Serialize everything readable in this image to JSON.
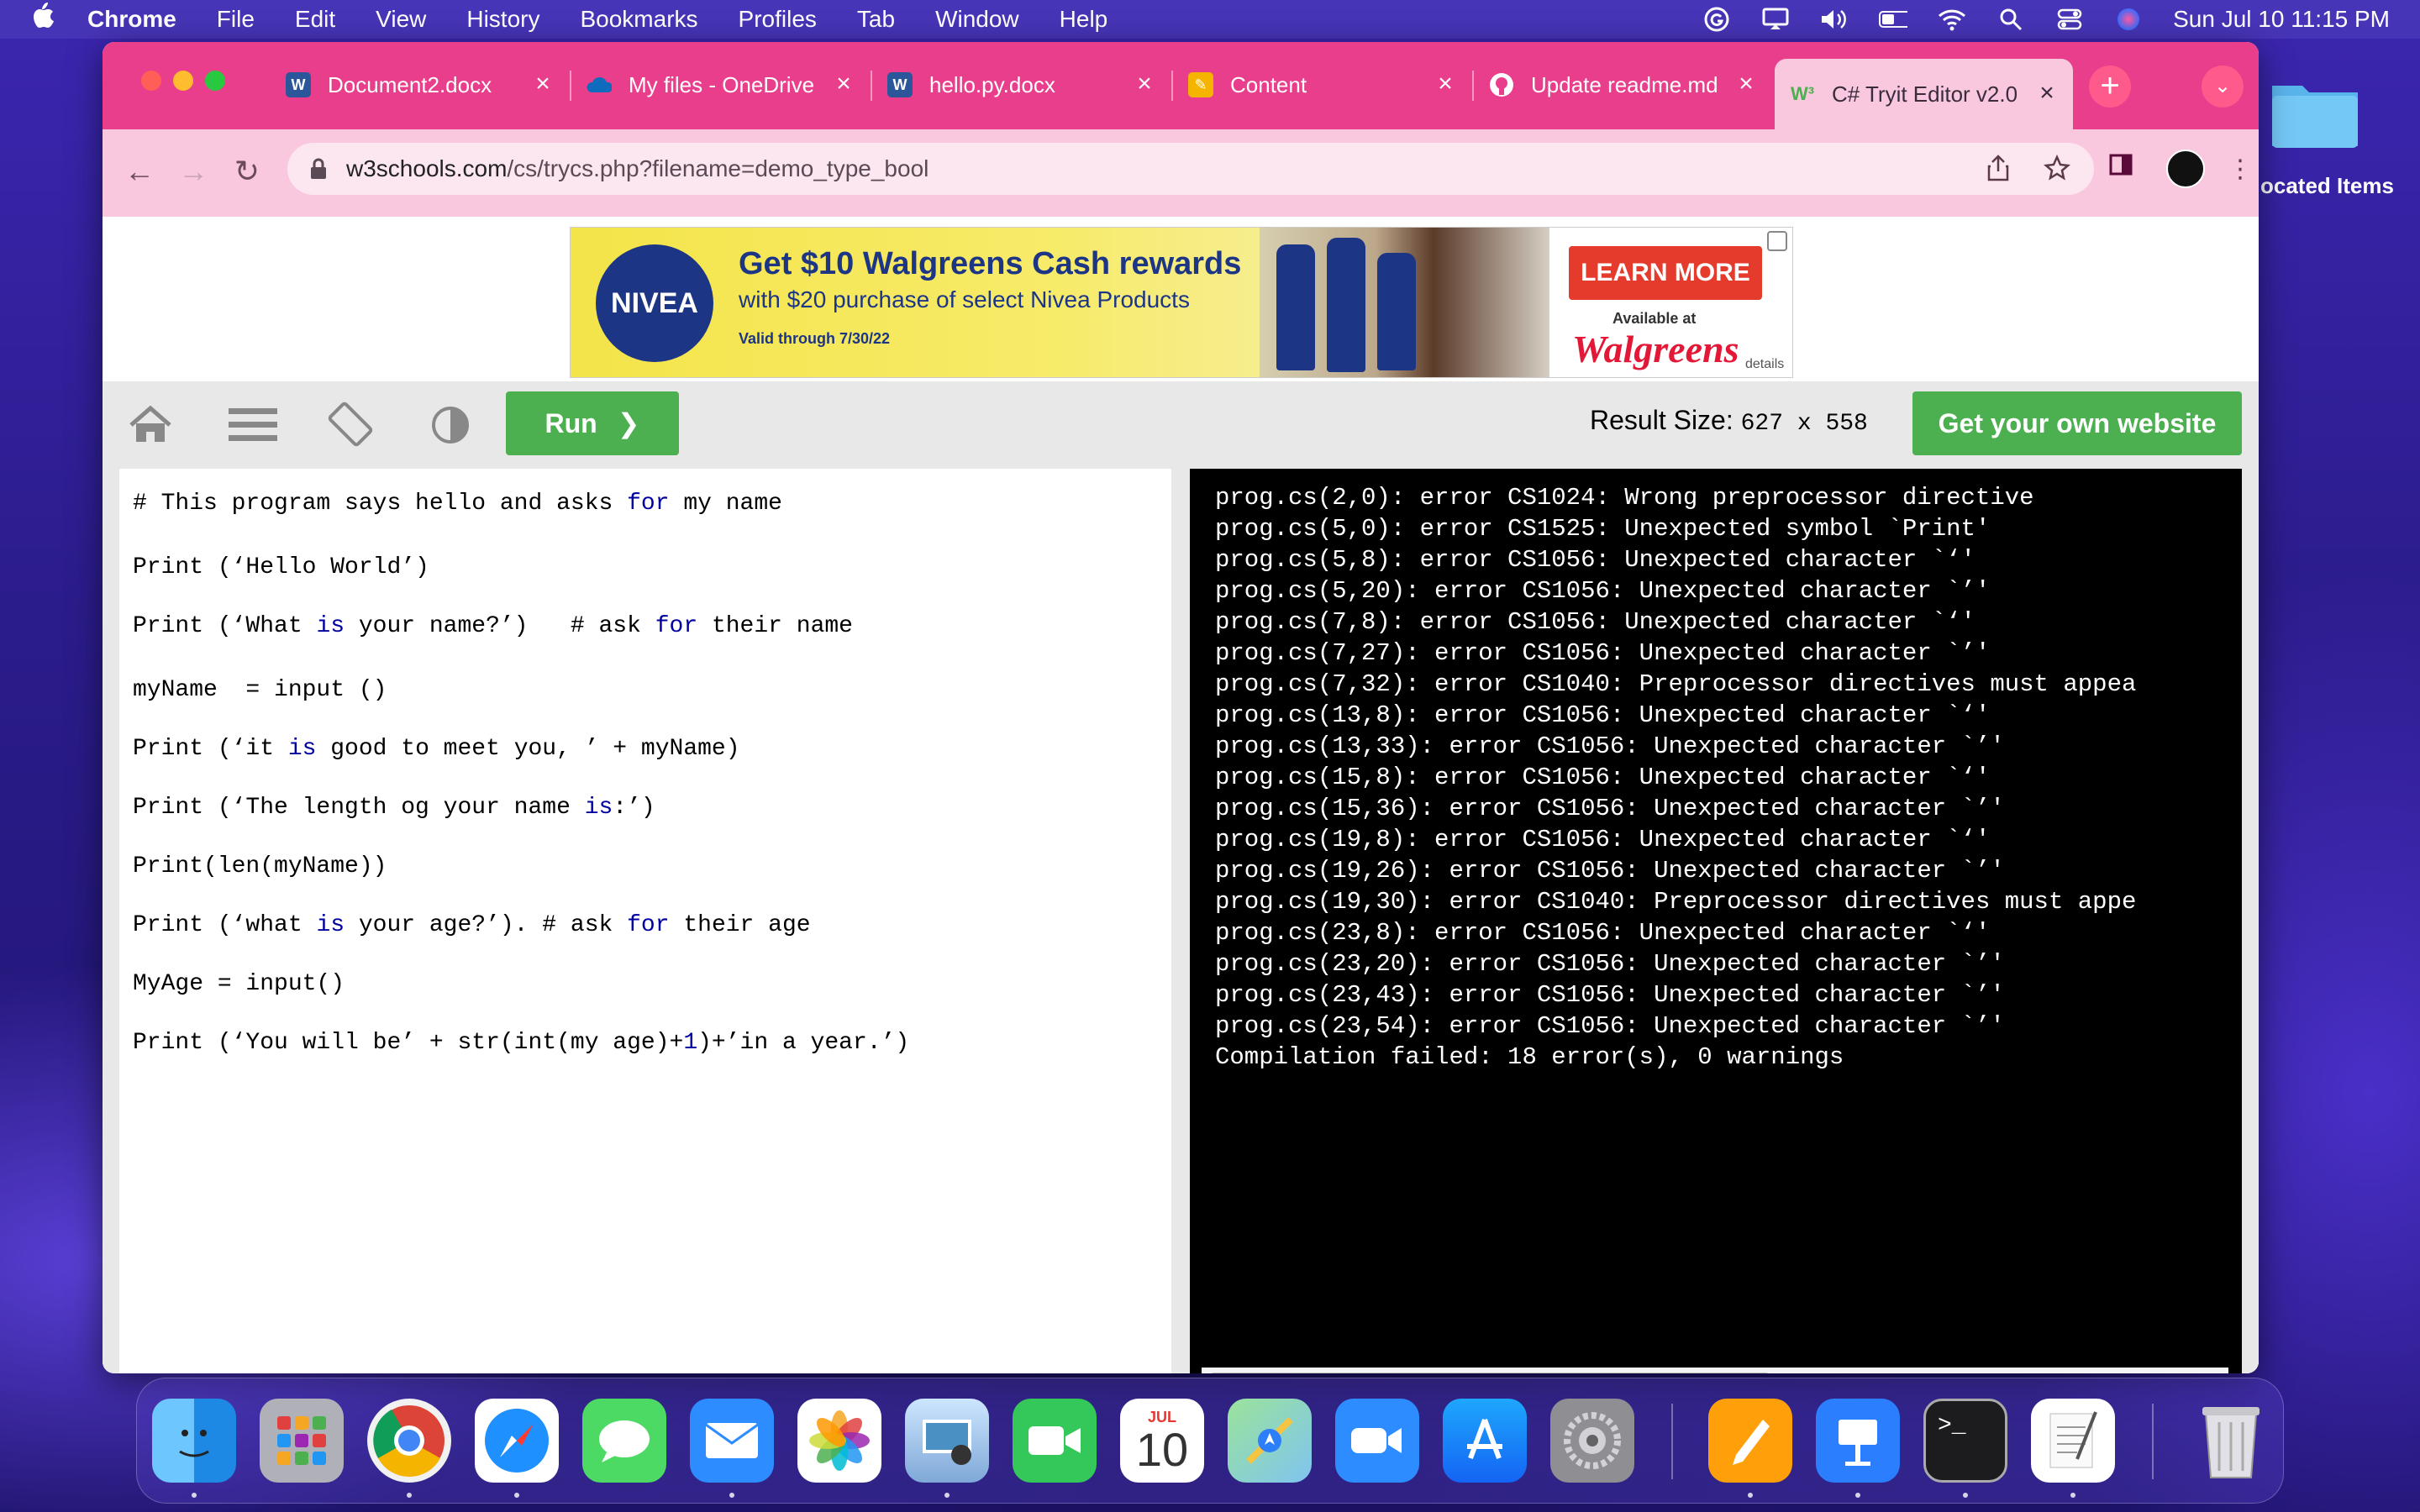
{
  "menubar": {
    "app_name": "Chrome",
    "items": [
      "File",
      "Edit",
      "View",
      "History",
      "Bookmarks",
      "Profiles",
      "Tab",
      "Window",
      "Help"
    ],
    "clock": "Sun Jul 10  11:15 PM"
  },
  "desktop": {
    "folder_label": "ocated Items"
  },
  "tabs": [
    {
      "title": "Document2.docx",
      "icon": "word-icon"
    },
    {
      "title": "My files - OneDrive",
      "icon": "onedrive-icon"
    },
    {
      "title": "hello.py.docx",
      "icon": "word-icon"
    },
    {
      "title": "Content",
      "icon": "notes-icon"
    },
    {
      "title": "Update readme.md",
      "icon": "github-icon"
    },
    {
      "title": "C# Tryit Editor v2.0",
      "icon": "w3schools-icon",
      "active": true
    }
  ],
  "address": {
    "host": "w3schools.com",
    "path": "/cs/trycs.php?filename=demo_type_bool"
  },
  "ad": {
    "brand": "NIVEA",
    "headline": "Get $10 Walgreens Cash rewards",
    "subline": "with $20 purchase of select Nivea Products",
    "valid": "Valid through 7/30/22",
    "cta": "LEARN MORE",
    "available": "Available at",
    "store": "Walgreens",
    "details": "details"
  },
  "w3toolbar": {
    "run_label": "Run",
    "result_size_label": "Result Size:",
    "result_size_value": "627 x 558",
    "get_own_label": "Get your own website"
  },
  "code": [
    {
      "parts": [
        [
          "t",
          "# This program says hello and asks "
        ],
        [
          "k",
          "for"
        ],
        [
          "t",
          " my name"
        ]
      ]
    },
    {
      "parts": []
    },
    {
      "parts": [
        [
          "t",
          "Print (‘Hello World’)"
        ]
      ]
    },
    {
      "parts": [
        [
          "t",
          "Print (‘What "
        ],
        [
          "k",
          "is"
        ],
        [
          "t",
          " your name?’)   # ask "
        ],
        [
          "k",
          "for"
        ],
        [
          "t",
          " their name"
        ]
      ]
    },
    {
      "parts": []
    },
    {
      "parts": [
        [
          "t",
          "myName  = input ()"
        ]
      ]
    },
    {
      "parts": [
        [
          "t",
          "Print (‘it "
        ],
        [
          "k",
          "is"
        ],
        [
          "t",
          " good to meet you, ’ + myName)"
        ]
      ]
    },
    {
      "parts": [
        [
          "t",
          "Print (‘The length og your name "
        ],
        [
          "k",
          "is"
        ],
        [
          "t",
          ":’)"
        ]
      ]
    },
    {
      "parts": [
        [
          "t",
          "Print(len(myName))"
        ]
      ]
    },
    {
      "parts": [
        [
          "t",
          "Print (‘what "
        ],
        [
          "k",
          "is"
        ],
        [
          "t",
          " your age?’). # ask "
        ],
        [
          "k",
          "for"
        ],
        [
          "t",
          " their age"
        ]
      ]
    },
    {
      "parts": [
        [
          "t",
          "MyAge = input()"
        ]
      ]
    },
    {
      "parts": [
        [
          "t",
          "Print (‘You will be’ + str(int(my age)+"
        ],
        [
          "k",
          "1"
        ],
        [
          "t",
          ")+’in a year.’)"
        ]
      ]
    }
  ],
  "output": [
    "prog.cs(2,0): error CS1024: Wrong preprocessor directive",
    "prog.cs(5,0): error CS1525: Unexpected symbol `Print'",
    "prog.cs(5,8): error CS1056: Unexpected character `‘'",
    "prog.cs(5,20): error CS1056: Unexpected character `’'",
    "prog.cs(7,8): error CS1056: Unexpected character `‘'",
    "prog.cs(7,27): error CS1056: Unexpected character `’'",
    "prog.cs(7,32): error CS1040: Preprocessor directives must appea",
    "prog.cs(13,8): error CS1056: Unexpected character `‘'",
    "prog.cs(13,33): error CS1056: Unexpected character `’'",
    "prog.cs(15,8): error CS1056: Unexpected character `‘'",
    "prog.cs(15,36): error CS1056: Unexpected character `’'",
    "prog.cs(19,8): error CS1056: Unexpected character `‘'",
    "prog.cs(19,26): error CS1056: Unexpected character `’'",
    "prog.cs(19,30): error CS1040: Preprocessor directives must appe",
    "prog.cs(23,8): error CS1056: Unexpected character `‘'",
    "prog.cs(23,20): error CS1056: Unexpected character `’'",
    "prog.cs(23,43): error CS1056: Unexpected character `’'",
    "prog.cs(23,54): error CS1056: Unexpected character `’'",
    "Compilation failed: 18 error(s), 0 warnings"
  ],
  "dock": {
    "calendar_month": "JUL",
    "calendar_day": "10",
    "apps": [
      "finder-icon",
      "launchpad-icon",
      "chrome-icon",
      "safari-icon",
      "messages-icon",
      "mail-icon",
      "photos-icon",
      "preview-icon",
      "facetime-icon",
      "calendar-icon",
      "maps-icon",
      "zoom-icon",
      "app-store-icon",
      "system-preferences-icon",
      "pages-icon",
      "keynote-icon",
      "terminal-icon",
      "textedit-icon",
      "trash-icon"
    ]
  },
  "colors": {
    "tabstrip": "#e83e8c",
    "toolbar": "#f9c8de",
    "w3green": "#4caf50",
    "keyword": "#0000a0"
  }
}
